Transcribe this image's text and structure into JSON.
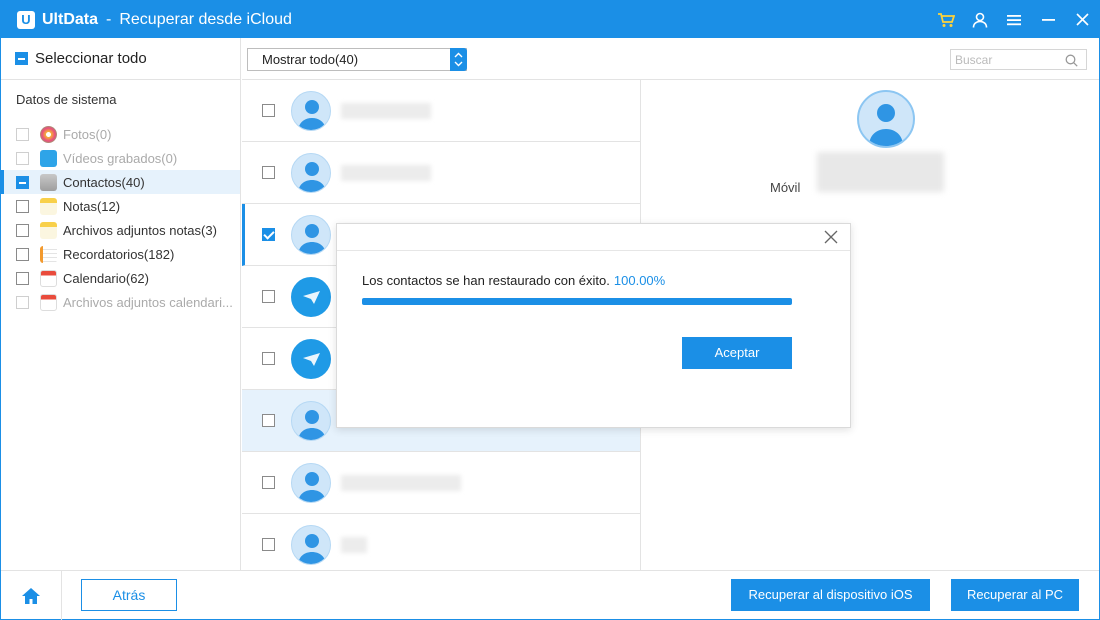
{
  "titlebar": {
    "app_name": "UltData",
    "separator": "-",
    "subtitle": "Recuperar desde iCloud",
    "icons": [
      "cart-icon",
      "user-icon",
      "menu-icon",
      "minimize-icon",
      "close-icon"
    ]
  },
  "sidebar": {
    "select_all": "Seleccionar todo",
    "section_title": "Datos de sistema",
    "items": [
      {
        "label": "Fotos(0)",
        "state": "disabled",
        "icon": "photos-icon"
      },
      {
        "label": "Vídeos grabados(0)",
        "state": "disabled",
        "icon": "videos-icon"
      },
      {
        "label": "Contactos(40)",
        "state": "partial",
        "icon": "contacts-icon"
      },
      {
        "label": "Notas(12)",
        "state": "unchecked",
        "icon": "notes-icon"
      },
      {
        "label": "Archivos adjuntos notas(3)",
        "state": "unchecked",
        "icon": "notes-attachments-icon"
      },
      {
        "label": "Recordatorios(182)",
        "state": "unchecked",
        "icon": "reminders-icon"
      },
      {
        "label": "Calendario(62)",
        "state": "unchecked",
        "icon": "calendar-icon"
      },
      {
        "label": "Archivos adjuntos calendari...",
        "state": "disabled",
        "icon": "calendar-attachments-icon"
      }
    ]
  },
  "toolbar": {
    "filter_value": "Mostrar todo(40)",
    "search_placeholder": "Buscar"
  },
  "contacts": [
    {
      "checked": false,
      "avatar": "person"
    },
    {
      "checked": false,
      "avatar": "person"
    },
    {
      "checked": true,
      "avatar": "person"
    },
    {
      "checked": false,
      "avatar": "app"
    },
    {
      "checked": false,
      "avatar": "app"
    },
    {
      "checked": false,
      "avatar": "person"
    },
    {
      "checked": false,
      "avatar": "person"
    },
    {
      "checked": false,
      "avatar": "person"
    }
  ],
  "detail": {
    "mobile_label": "Móvil"
  },
  "footer": {
    "back_label": "Atrás",
    "recover_ios_label": "Recuperar al dispositivo iOS",
    "recover_pc_label": "Recuperar al PC"
  },
  "dialog": {
    "message": "Los contactos se han restaurado con éxito.",
    "percent_text": "100.00%",
    "progress": 1.0,
    "accept_label": "Aceptar"
  },
  "colors": {
    "accent": "#1b8fe6",
    "highlight_bg": "#e6f2fc"
  }
}
